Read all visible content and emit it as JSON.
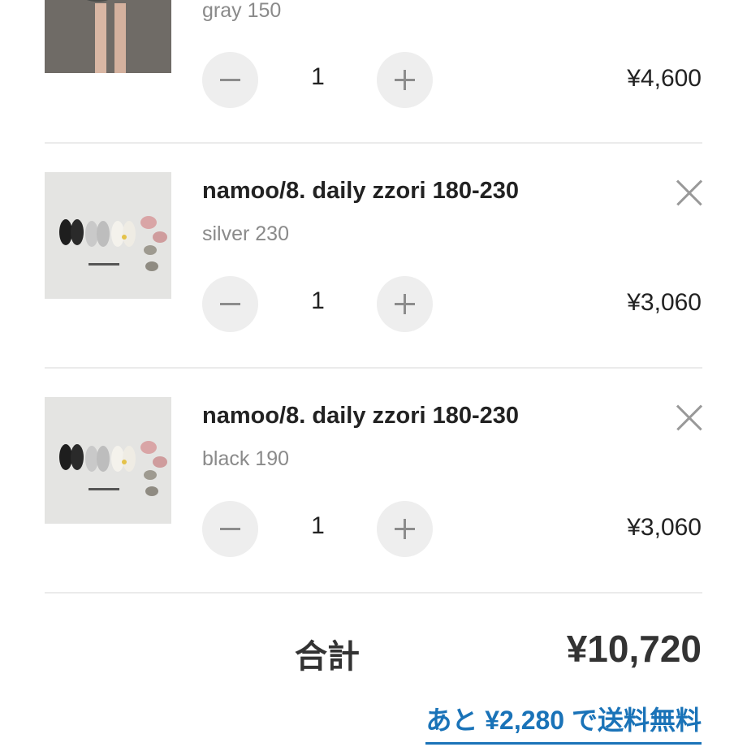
{
  "items": [
    {
      "name": "",
      "variant": "gray 150",
      "quantity": "1",
      "price": "¥4,600",
      "image": "child-camo-outfit-photo"
    },
    {
      "name": "namoo/8. daily zzori 180-230",
      "variant": "silver 230",
      "quantity": "1",
      "price": "¥3,060",
      "image": "sandals-lineup-photo"
    },
    {
      "name": "namoo/8. daily zzori 180-230",
      "variant": "black 190",
      "quantity": "1",
      "price": "¥3,060",
      "image": "sandals-lineup-photo"
    }
  ],
  "summary": {
    "total_label": "合計",
    "total_value": "¥10,720",
    "free_shipping_link": "あと ¥2,280 で送料無料"
  },
  "icons": {
    "remove": "close-icon",
    "decrease": "minus-icon",
    "increase": "plus-icon"
  },
  "colors": {
    "accent": "#1a73b8",
    "stepper_bg": "#eeeeee",
    "muted_text": "#8a8a8a",
    "divider": "#ebebeb"
  }
}
